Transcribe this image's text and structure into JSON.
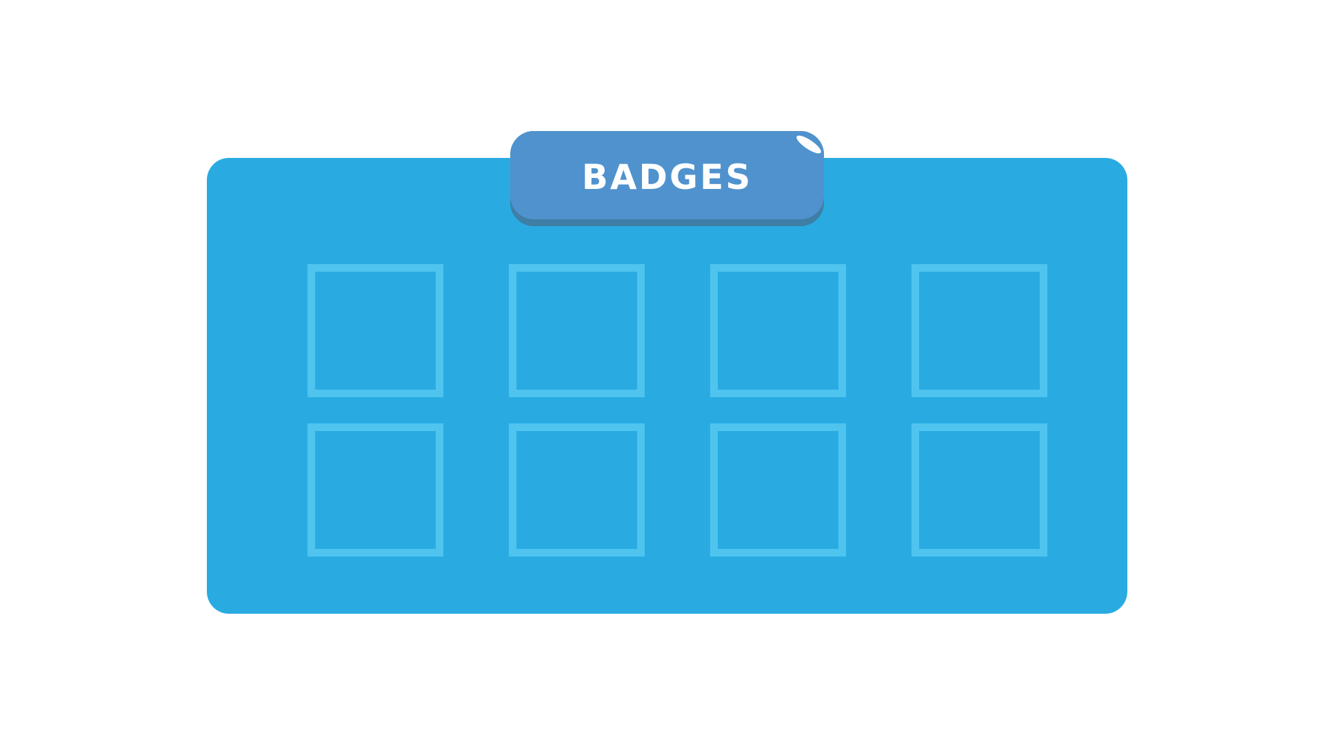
{
  "header": {
    "title": "BADGES"
  },
  "badges": {
    "slots": [
      {
        "row": 1,
        "column": 1,
        "state": "empty"
      },
      {
        "row": 1,
        "column": 2,
        "state": "empty"
      },
      {
        "row": 1,
        "column": 3,
        "state": "empty"
      },
      {
        "row": 1,
        "column": 4,
        "state": "empty"
      },
      {
        "row": 2,
        "column": 1,
        "state": "empty"
      },
      {
        "row": 2,
        "column": 2,
        "state": "empty"
      },
      {
        "row": 2,
        "column": 3,
        "state": "empty"
      },
      {
        "row": 2,
        "column": 4,
        "state": "empty"
      }
    ]
  },
  "colors": {
    "panel": "#29abe2",
    "title_tab": "#5092cd",
    "title_tab_shadow": "#3f7ea5",
    "slot_border": "#4fc4ef",
    "text": "#ffffff"
  }
}
